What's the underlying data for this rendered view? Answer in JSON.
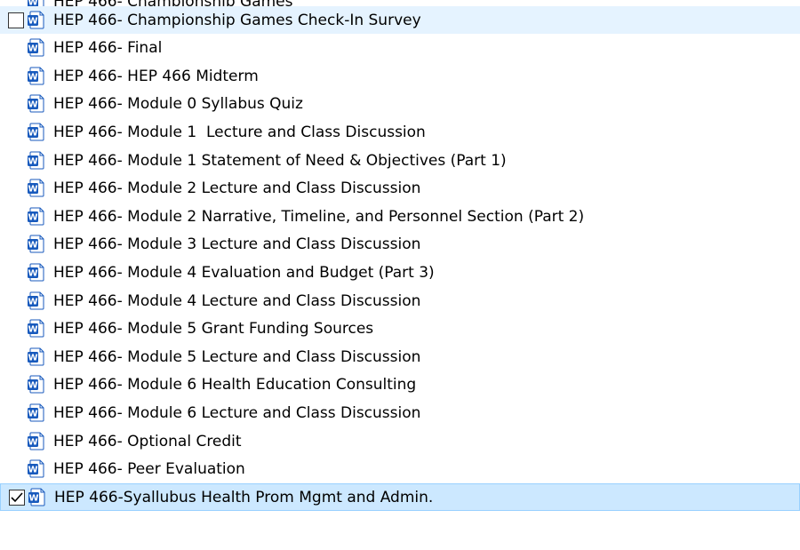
{
  "file_list": {
    "partial_top_item": {
      "name": "HEP 466- Championship Games"
    },
    "items": [
      {
        "name": "HEP 466- Championship Games Check-In Survey",
        "state": "hover",
        "checked": false
      },
      {
        "name": "HEP 466- Final",
        "state": "normal",
        "checked": false
      },
      {
        "name": "HEP 466- HEP 466 Midterm",
        "state": "normal",
        "checked": false
      },
      {
        "name": "HEP 466- Module 0 Syllabus Quiz",
        "state": "normal",
        "checked": false
      },
      {
        "name": "HEP 466- Module 1  Lecture and Class Discussion",
        "state": "normal",
        "checked": false
      },
      {
        "name": "HEP 466- Module 1 Statement of Need & Objectives (Part 1)",
        "state": "normal",
        "checked": false
      },
      {
        "name": "HEP 466- Module 2 Lecture and Class Discussion",
        "state": "normal",
        "checked": false
      },
      {
        "name": "HEP 466- Module 2 Narrative, Timeline, and Personnel Section (Part 2)",
        "state": "normal",
        "checked": false
      },
      {
        "name": "HEP 466- Module 3 Lecture and Class Discussion",
        "state": "normal",
        "checked": false
      },
      {
        "name": "HEP 466- Module 4 Evaluation and Budget (Part 3)",
        "state": "normal",
        "checked": false
      },
      {
        "name": "HEP 466- Module 4 Lecture and Class Discussion",
        "state": "normal",
        "checked": false
      },
      {
        "name": "HEP 466- Module 5 Grant Funding Sources",
        "state": "normal",
        "checked": false
      },
      {
        "name": "HEP 466- Module 5 Lecture and Class Discussion",
        "state": "normal",
        "checked": false
      },
      {
        "name": "HEP 466- Module 6 Health Education Consulting",
        "state": "normal",
        "checked": false
      },
      {
        "name": "HEP 466- Module 6 Lecture and Class Discussion",
        "state": "normal",
        "checked": false
      },
      {
        "name": "HEP 466- Optional Credit",
        "state": "normal",
        "checked": false
      },
      {
        "name": "HEP 466- Peer Evaluation",
        "state": "normal",
        "checked": false
      },
      {
        "name": "HEP 466-Syallubus Health Prom Mgmt and Admin.",
        "state": "selected",
        "checked": true
      }
    ]
  },
  "icons": {
    "file_icon": "word-document-icon",
    "check_icon": "checkmark-icon"
  },
  "colors": {
    "hover_background": "#e5f3ff",
    "selected_background": "#cce8ff",
    "selected_border": "#99d1ff",
    "word_blue": "#185abd"
  }
}
